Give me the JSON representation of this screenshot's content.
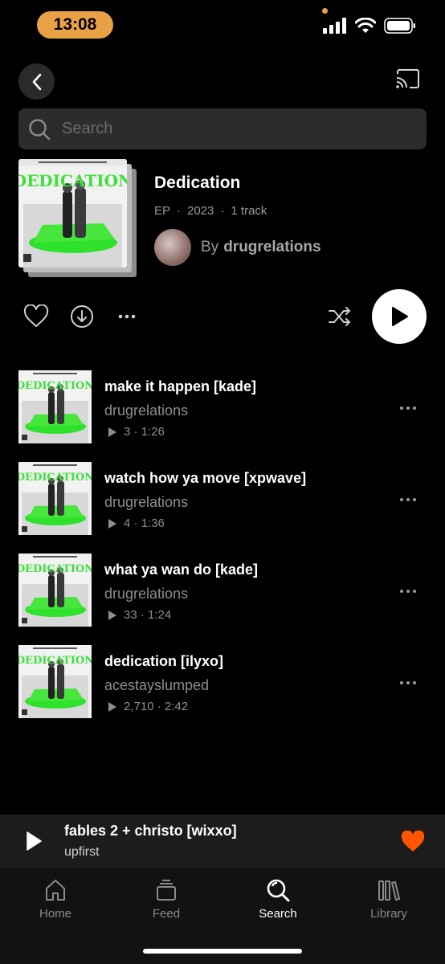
{
  "status_bar": {
    "time": "13:08"
  },
  "search": {
    "placeholder": "Search"
  },
  "album": {
    "title": "Dedication",
    "type": "EP",
    "year": "2023",
    "track_count": "1 track",
    "by_label": "By",
    "artist": "drugrelations",
    "cover_text": "DEDICATION"
  },
  "tracks": [
    {
      "title": "make it happen [kade]",
      "artist": "drugrelations",
      "plays": "3",
      "duration": "1:26"
    },
    {
      "title": "watch how ya move [xpwave]",
      "artist": "drugrelations",
      "plays": "4",
      "duration": "1:36"
    },
    {
      "title": "what ya wan do [kade]",
      "artist": "drugrelations",
      "plays": "33",
      "duration": "1:24"
    },
    {
      "title": "dedication [ilyxo]",
      "artist": "acestayslumped",
      "plays": "2,710",
      "duration": "2:42"
    }
  ],
  "now_playing": {
    "title": "fables 2 + christo [wixxo]",
    "artist": "upfirst"
  },
  "tabs": [
    {
      "label": "Home",
      "icon": "home-icon",
      "active": false
    },
    {
      "label": "Feed",
      "icon": "feed-icon",
      "active": false
    },
    {
      "label": "Search",
      "icon": "search-icon",
      "active": true
    },
    {
      "label": "Library",
      "icon": "library-icon",
      "active": false
    }
  ],
  "colors": {
    "accent_orange": "#ff5500",
    "status_pill": "#e8a245",
    "cover_green": "#3fe03a"
  }
}
